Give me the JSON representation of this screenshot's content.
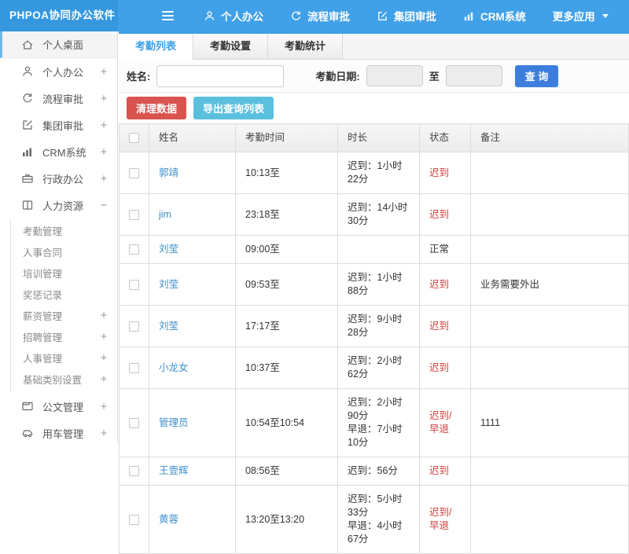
{
  "header": {
    "logo": "PHPOA协同办公软件",
    "nav": [
      {
        "label": "个人办公",
        "icon": "person-icon"
      },
      {
        "label": "流程审批",
        "icon": "flow-icon"
      },
      {
        "label": "集团审批",
        "icon": "edit-icon"
      },
      {
        "label": "CRM系统",
        "icon": "chart-icon"
      },
      {
        "label": "更多应用",
        "icon": "caret-down-icon"
      }
    ]
  },
  "sidebar": {
    "items": [
      {
        "label": "个人桌面",
        "icon": "home-icon"
      },
      {
        "label": "个人办公",
        "icon": "person-icon",
        "expander": "+"
      },
      {
        "label": "流程审批",
        "icon": "flow-icon",
        "expander": "+"
      },
      {
        "label": "集团审批",
        "icon": "edit-icon",
        "expander": "+"
      },
      {
        "label": "CRM系统",
        "icon": "chart-icon",
        "expander": "+"
      },
      {
        "label": "行政办公",
        "icon": "briefcase-icon",
        "expander": "+"
      },
      {
        "label": "人力资源",
        "icon": "book-icon",
        "expander": "−",
        "submenu": [
          {
            "label": "考勤管理"
          },
          {
            "label": "人事合同"
          },
          {
            "label": "培训管理"
          },
          {
            "label": "奖惩记录"
          },
          {
            "label": "薪资管理",
            "expander": "+"
          },
          {
            "label": "招聘管理",
            "expander": "+"
          },
          {
            "label": "人事管理",
            "expander": "+"
          },
          {
            "label": "基础类别设置",
            "expander": "+"
          }
        ]
      },
      {
        "label": "公文管理",
        "icon": "document-icon",
        "expander": "+"
      },
      {
        "label": "用车管理",
        "icon": "car-icon",
        "expander": "+"
      }
    ]
  },
  "tabs": [
    {
      "label": "考勤列表",
      "active": true
    },
    {
      "label": "考勤设置",
      "active": false
    },
    {
      "label": "考勤统计",
      "active": false
    }
  ],
  "filter": {
    "name_label": "姓名:",
    "name_value": "",
    "date_label": "考勤日期:",
    "date_from_value": "",
    "to_label": "至",
    "date_to_value": "",
    "search_label": "查 询"
  },
  "toolbar": {
    "clean_label": "清理数据",
    "export_label": "导出查询列表"
  },
  "table": {
    "headers": [
      "姓名",
      "考勤时间",
      "时长",
      "状态",
      "备注"
    ],
    "rows": [
      {
        "name": "郭靖",
        "time": "10:13至",
        "duration": "迟到：1小时22分",
        "status": "迟到",
        "status_color": "#d2403c",
        "note": ""
      },
      {
        "name": "jim",
        "time": "23:18至",
        "duration": "迟到：14小时30分",
        "status": "迟到",
        "status_color": "#d2403c",
        "note": ""
      },
      {
        "name": "刘莹",
        "time": "09:00至",
        "duration": "",
        "status": "正常",
        "status_color": "#333333",
        "note": ""
      },
      {
        "name": "刘莹",
        "time": "09:53至",
        "duration": "迟到：1小时88分",
        "status": "迟到",
        "status_color": "#d2403c",
        "note": "业务需要外出"
      },
      {
        "name": "刘莹",
        "time": "17:17至",
        "duration": "迟到：9小时28分",
        "status": "迟到",
        "status_color": "#d2403c",
        "note": ""
      },
      {
        "name": "小龙女",
        "time": "10:37至",
        "duration": "迟到：2小时62分",
        "status": "迟到",
        "status_color": "#d2403c",
        "note": ""
      },
      {
        "name": "管理员",
        "time": "10:54至10:54",
        "duration": "迟到：2小时90分\n早退：7小时10分",
        "status": "迟到/早退",
        "status_color": "#d2403c",
        "note": "1111"
      },
      {
        "name": "王壹辉",
        "time": "08:56至",
        "duration": "迟到：56分",
        "status": "迟到",
        "status_color": "#d2403c",
        "note": ""
      },
      {
        "name": "黄蓉",
        "time": "13:20至13:20",
        "duration": "迟到：5小时33分\n早退：4小时67分",
        "status": "迟到/早退",
        "status_color": "#d2403c",
        "note": ""
      }
    ]
  },
  "colors": {
    "navbar": "#40a0e8",
    "logo_bg": "#3597de",
    "accent": "#3d9fe8",
    "search_button": "#3d7edd",
    "danger": "#d9534f",
    "info": "#5bc0de",
    "link": "#3e8fcb",
    "status_late": "#d2403c"
  }
}
